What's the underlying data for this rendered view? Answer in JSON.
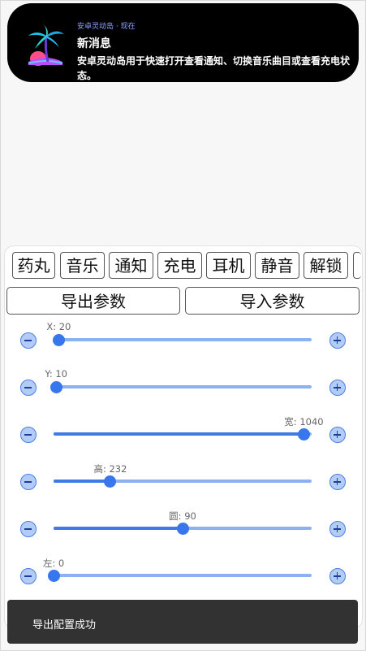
{
  "notification": {
    "app_line": "安卓灵动岛 · 现在",
    "title": "新消息",
    "body": "安卓灵动岛用于快速打开查看通知、切换音乐曲目或查看充电状态。",
    "icon": "palm-island-icon"
  },
  "mode_tabs": [
    "药丸",
    "音乐",
    "通知",
    "充电",
    "耳机",
    "静音",
    "解锁"
  ],
  "actions": {
    "export": "导出参数",
    "import": "导入参数"
  },
  "sliders": [
    {
      "label": "X: 20",
      "fraction": 0.02
    },
    {
      "label": "Y: 10",
      "fraction": 0.01
    },
    {
      "label": "宽: 1040",
      "fraction": 0.97
    },
    {
      "label": "高: 232",
      "fraction": 0.22
    },
    {
      "label": "圆: 90",
      "fraction": 0.5
    },
    {
      "label": "左: 0",
      "fraction": 0.0
    }
  ],
  "toast": {
    "message": "导出配置成功"
  },
  "colors": {
    "accent": "#3876ee",
    "track": "#8cb1f0",
    "toast_bg": "#323232"
  }
}
